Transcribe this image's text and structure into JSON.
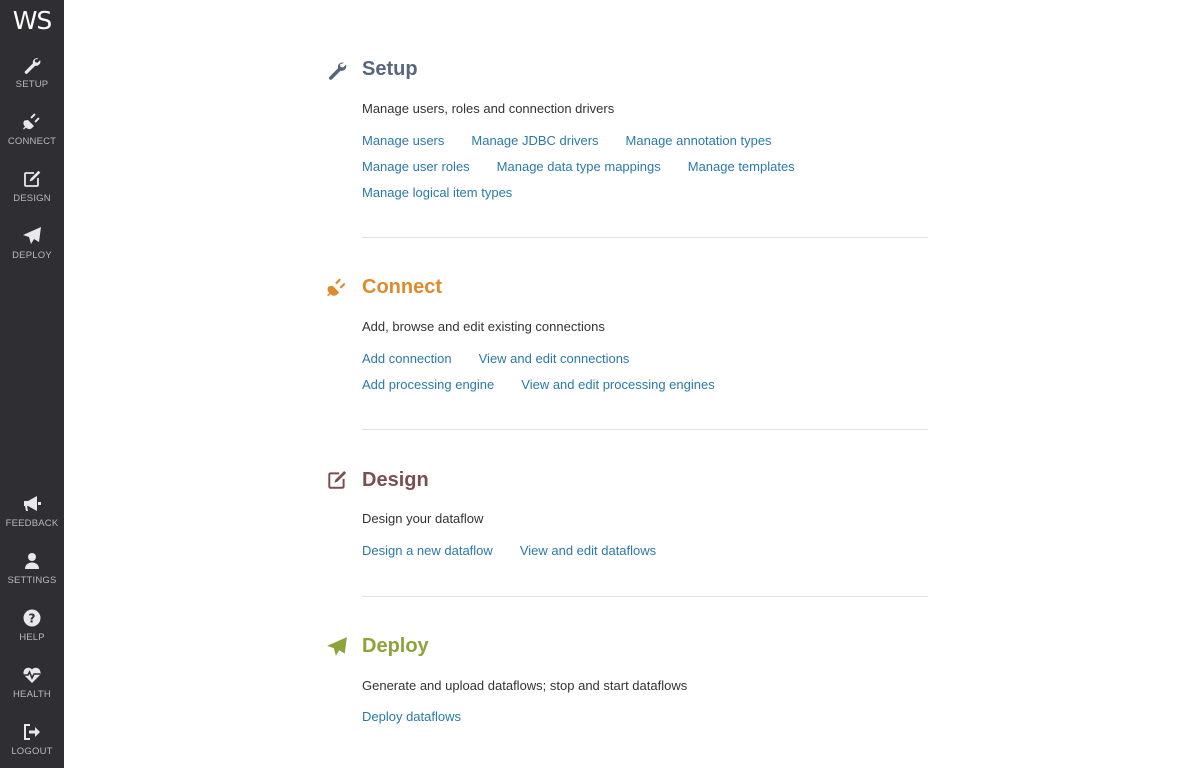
{
  "logo": "WS",
  "nav_top": [
    {
      "label": "SETUP",
      "icon": "wrench-icon"
    },
    {
      "label": "CONNECT",
      "icon": "plug-icon"
    },
    {
      "label": "DESIGN",
      "icon": "edit-icon"
    },
    {
      "label": "DEPLOY",
      "icon": "paper-plane-icon"
    }
  ],
  "nav_bottom": [
    {
      "label": "FEEDBACK",
      "icon": "megaphone-icon"
    },
    {
      "label": "SETTINGS",
      "icon": "user-icon"
    },
    {
      "label": "HELP",
      "icon": "question-circle-icon"
    },
    {
      "label": "HEALTH",
      "icon": "heartbeat-icon"
    },
    {
      "label": "LOGOUT",
      "icon": "sign-out-icon"
    }
  ],
  "colors": {
    "sidebar": "#2f2f33",
    "setup": "#56677a",
    "connect": "#e08a2c",
    "design": "#7a4f4f",
    "deploy": "#8ea33a",
    "link": "#2a7aa8"
  },
  "sections": {
    "setup": {
      "title": "Setup",
      "description": "Manage users, roles and connection drivers",
      "rows": [
        [
          "Manage users",
          "Manage JDBC drivers",
          "Manage annotation types"
        ],
        [
          "Manage user roles",
          "Manage data type mappings",
          "Manage templates"
        ],
        [
          "Manage logical item types"
        ]
      ]
    },
    "connect": {
      "title": "Connect",
      "description": "Add, browse and edit existing connections",
      "rows": [
        [
          "Add connection",
          "View and edit connections"
        ],
        [
          "Add processing engine",
          "View and edit processing engines"
        ]
      ]
    },
    "design": {
      "title": "Design",
      "description": "Design your dataflow",
      "rows": [
        [
          "Design a new dataflow",
          "View and edit dataflows"
        ]
      ]
    },
    "deploy": {
      "title": "Deploy",
      "description": "Generate and upload dataflows; stop and start dataflows",
      "rows": [
        [
          "Deploy dataflows"
        ]
      ]
    }
  }
}
